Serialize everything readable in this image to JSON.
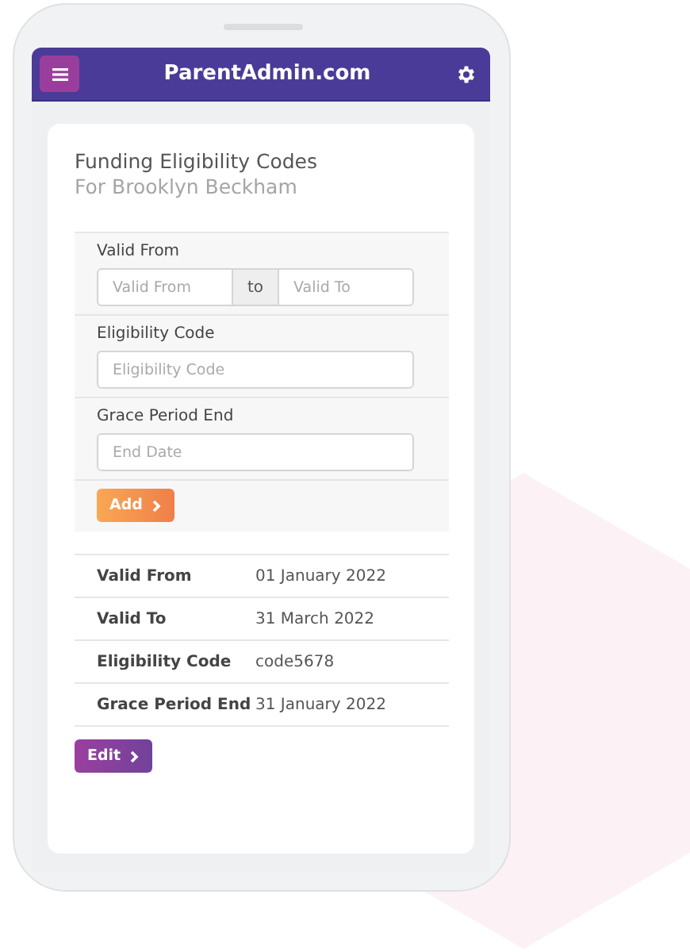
{
  "header": {
    "title": "ParentAdmin.com"
  },
  "card": {
    "title": "Funding Eligibility Codes",
    "subtitle": "For Brooklyn Beckham",
    "form": {
      "fields": [
        {
          "kind": "range",
          "label": "Valid From",
          "from_placeholder": "Valid From",
          "separator": "to",
          "to_placeholder": "Valid To"
        },
        {
          "kind": "single",
          "label": "Eligibility Code",
          "placeholder": "Eligibility Code"
        },
        {
          "kind": "single",
          "label": "Grace Period End",
          "placeholder": "End Date"
        }
      ],
      "add_button": "Add"
    },
    "details": [
      {
        "label": "Valid From",
        "value": "01 January 2022"
      },
      {
        "label": "Valid To",
        "value": "31 March 2022"
      },
      {
        "label": "Eligibility Code",
        "value": "code5678"
      },
      {
        "label": "Grace Period End",
        "value": "31 January 2022"
      }
    ],
    "edit_button": "Edit"
  }
}
